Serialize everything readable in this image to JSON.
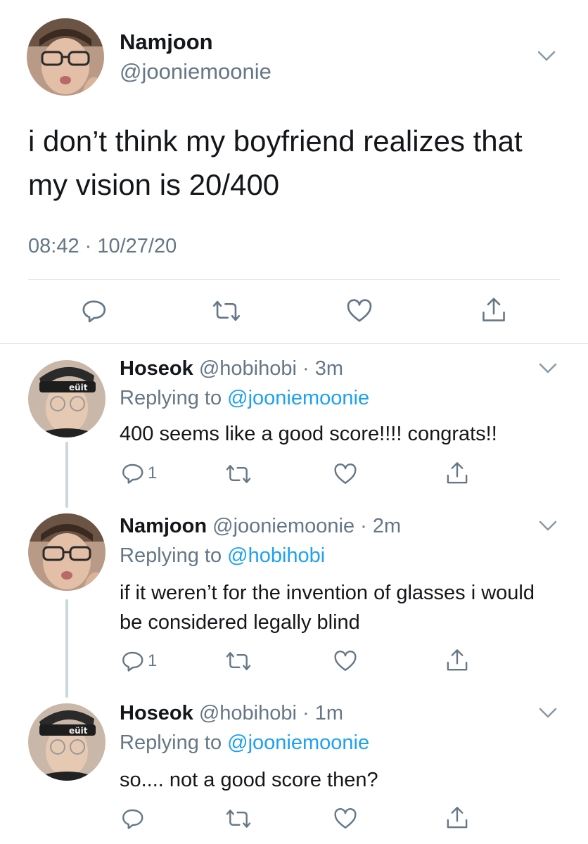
{
  "colors": {
    "accent": "#1da1f2",
    "secondary": "#657786",
    "text": "#14171a",
    "divider": "#e1e8ed",
    "thread": "#ccd6dd"
  },
  "main_tweet": {
    "name": "Namjoon",
    "handle": "@jooniemoonie",
    "text": "i don’t think my boyfriend realizes that my vision is 20/400",
    "timestamp": "08:42 · 10/27/20",
    "icons": [
      "reply-icon",
      "retweet-icon",
      "like-icon",
      "share-icon"
    ]
  },
  "replies": [
    {
      "name": "Hoseok",
      "handle_time": "@hobihobi · 3m",
      "replying_prefix": "Replying to ",
      "replying_to": "@jooniemoonie",
      "text": "400 seems like a good score!!!! congrats!!",
      "reply_count": "1"
    },
    {
      "name": "Namjoon",
      "handle_time": "@jooniemoonie · 2m",
      "replying_prefix": "Replying to ",
      "replying_to": "@hobihobi",
      "text": "if it weren’t for the invention of glasses i would be considered legally blind",
      "reply_count": "1"
    },
    {
      "name": "Hoseok",
      "handle_time": "@hobihobi · 1m",
      "replying_prefix": "Replying to ",
      "replying_to": "@jooniemoonie",
      "text": "so.... not a good score then?",
      "reply_count": ""
    }
  ]
}
